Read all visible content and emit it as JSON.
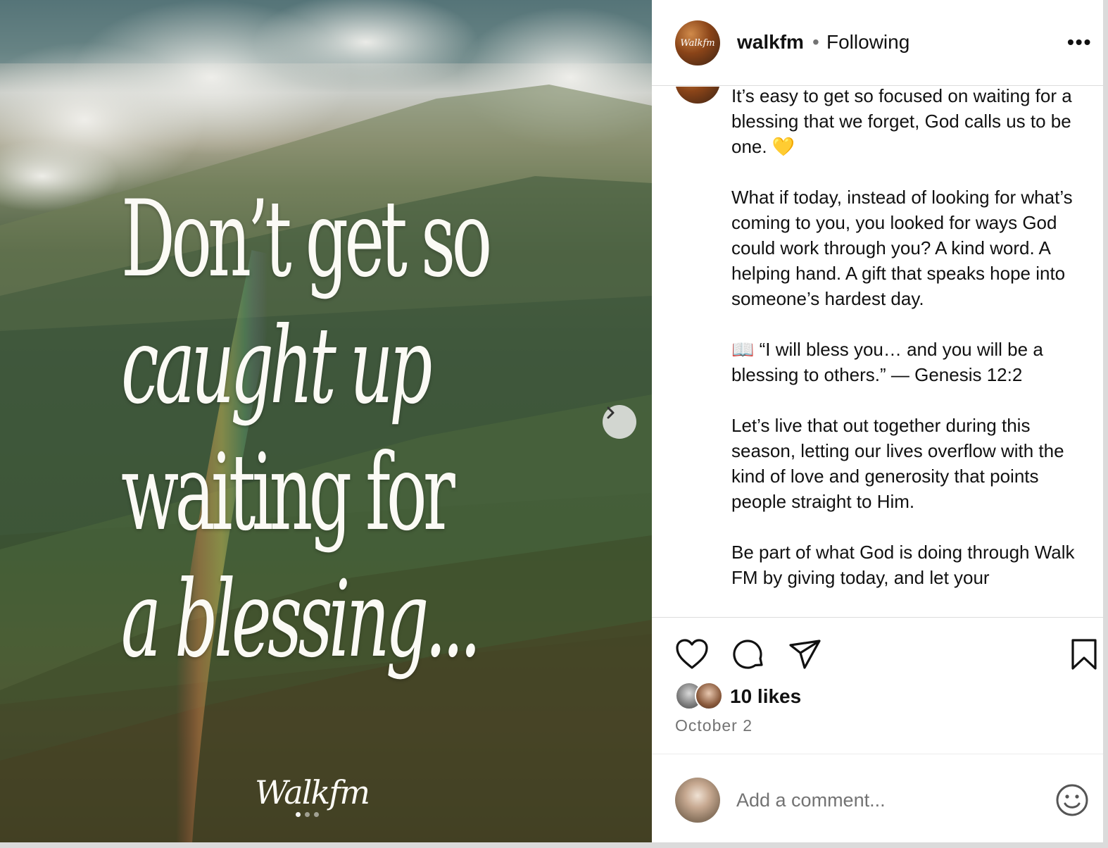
{
  "post_image": {
    "quote_lines": [
      "Don’t get so",
      "caught up",
      "waiting for",
      "a blessing..."
    ],
    "brand": "Walkfm",
    "carousel_dots": 3,
    "active_dot": 1
  },
  "header": {
    "username": "walkfm",
    "separator": "•",
    "follow_state": "Following",
    "more_label": "•••"
  },
  "caption": {
    "paragraphs": [
      "It’s easy to get so focused on waiting for a blessing that we forget, God calls us to be one. 💛",
      "What if today, instead of looking for what’s coming to you, you looked for ways God could work through you? A kind word. A helping hand. A gift that speaks hope into someone’s hardest day.",
      "📖 “I will bless you… and you will be a blessing to others.” — Genesis 12:2",
      "Let’s live that out together during this season, letting our lives overflow with the kind of love and generosity that points people straight to Him.",
      "Be part of what God is doing through Walk FM by giving today, and let your"
    ]
  },
  "actions": {
    "icons": [
      "heart-icon",
      "comment-icon",
      "share-icon",
      "bookmark-icon"
    ]
  },
  "likes": {
    "text": "10 likes"
  },
  "date": "October 2",
  "comment": {
    "placeholder": "Add a comment...",
    "value": ""
  }
}
